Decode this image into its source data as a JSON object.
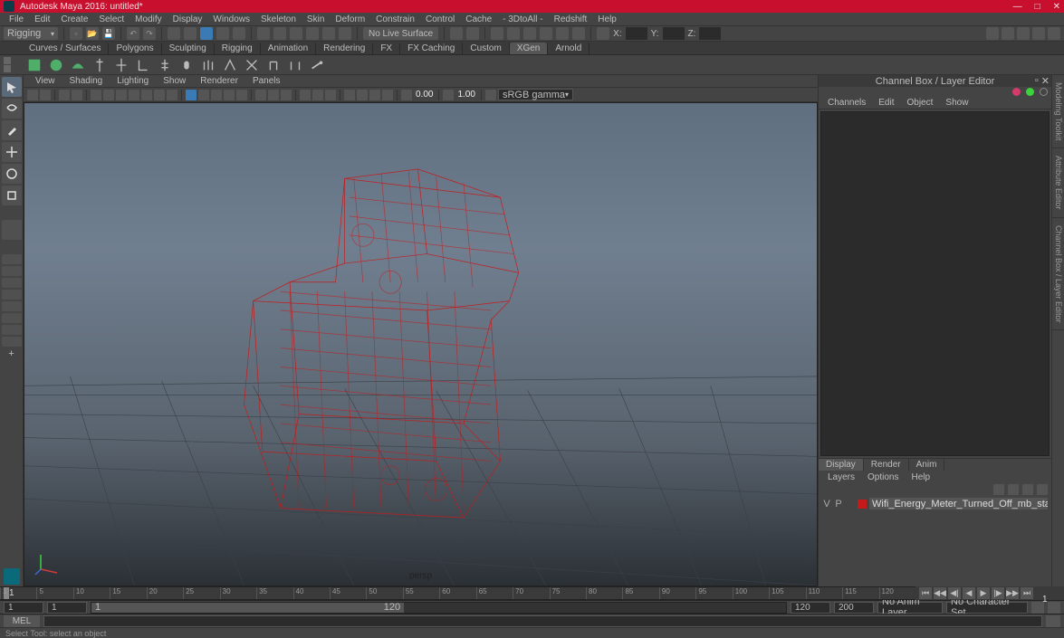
{
  "title": "Autodesk Maya 2016: untitled*",
  "window_controls": {
    "min": "—",
    "max": "□",
    "close": "✕"
  },
  "menu": [
    "File",
    "Edit",
    "Create",
    "Select",
    "Modify",
    "Display",
    "Windows",
    "Skeleton",
    "Skin",
    "Deform",
    "Constrain",
    "Control",
    "Cache",
    "- 3DtoAll -",
    "Redshift",
    "Help"
  ],
  "workspace_dropdown": "Rigging",
  "no_live": "No Live Surface",
  "coords": {
    "x": "X:",
    "y": "Y:",
    "z": "Z:"
  },
  "shelf_tabs": [
    "Curves / Surfaces",
    "Polygons",
    "Sculpting",
    "Rigging",
    "Animation",
    "Rendering",
    "FX",
    "FX Caching",
    "Custom",
    "XGen",
    "Arnold"
  ],
  "panel_menu": [
    "View",
    "Shading",
    "Lighting",
    "Show",
    "Renderer",
    "Panels"
  ],
  "viewport_field1": "0.00",
  "viewport_field2": "1.00",
  "viewport_colorspace": "sRGB gamma",
  "viewport_label": "persp",
  "channel_box_title": "Channel Box / Layer Editor",
  "cb_menu": [
    "Channels",
    "Edit",
    "Object",
    "Show"
  ],
  "layer_tabs": [
    "Display",
    "Render",
    "Anim"
  ],
  "layer_menu": [
    "Layers",
    "Options",
    "Help"
  ],
  "layer_row": {
    "v": "V",
    "p": "P",
    "name": "Wifi_Energy_Meter_Turned_Off_mb_standart:Wifi_Energ"
  },
  "right_vtabs": [
    "Modeling Toolkit",
    "Attribute Editor",
    "Channel Box / Layer Editor"
  ],
  "timeline": {
    "ticks": [
      "1",
      "5",
      "10",
      "15",
      "20",
      "25",
      "30",
      "35",
      "40",
      "45",
      "50",
      "55",
      "60",
      "65",
      "70",
      "75",
      "80",
      "85",
      "90",
      "95",
      "100",
      "105",
      "110",
      "115",
      "120"
    ],
    "start_label": "1",
    "end_label": "1"
  },
  "range": {
    "start_outer": "1",
    "start_inner": "1",
    "handle_start": "1",
    "handle_end": "120",
    "end_inner": "120",
    "end_outer": "200"
  },
  "anim_layer": "No Anim Layer",
  "char_set": "No Character Set",
  "cmd_lang": "MEL",
  "helpline": "Select Tool: select an object",
  "chart_data": null
}
